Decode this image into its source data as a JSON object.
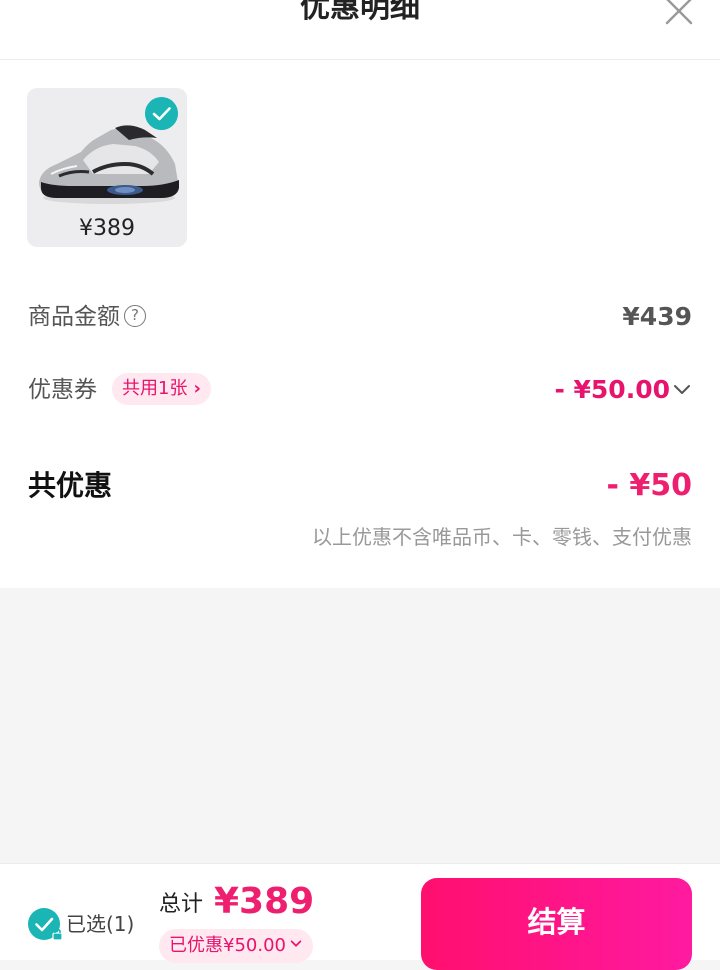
{
  "header": {
    "title": "优惠明细",
    "close_icon": "close-icon"
  },
  "product": {
    "price": "¥389",
    "selected": true,
    "image_desc_icon": "sneaker-image"
  },
  "summary": {
    "goods_amount_label": "商品金额",
    "goods_amount_help": "?",
    "goods_amount_value": "¥439",
    "coupon_label": "优惠券",
    "coupon_tag": "共用1张",
    "coupon_value": "- ¥50.00",
    "total_label": "共优惠",
    "total_value": "- ¥50",
    "disclaimer": "以上优惠不含唯品币、卡、零钱、支付优惠"
  },
  "bottom_bar": {
    "selected_label": "已选(1)",
    "sum_label": "总计",
    "sum_value": "¥389",
    "saved_label": "已优惠¥50.00",
    "checkout_label": "结算"
  },
  "colors": {
    "accent": "#ef1f6f",
    "teal": "#1bb5b5",
    "tag_bg": "#ffe8ef"
  }
}
